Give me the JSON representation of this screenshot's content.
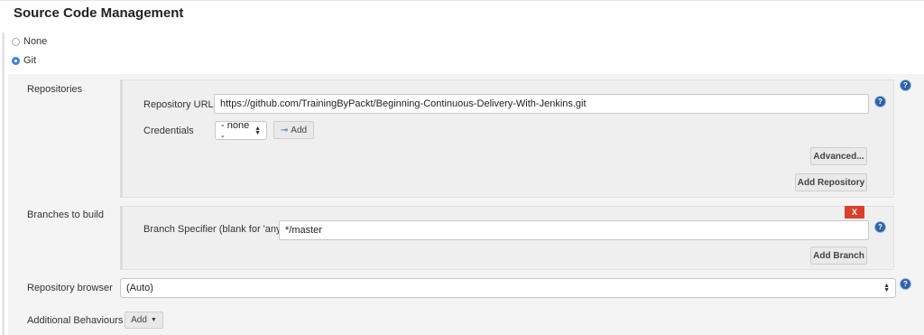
{
  "section": {
    "title": "Source Code Management"
  },
  "scm_options": [
    {
      "label": "None",
      "checked": false
    },
    {
      "label": "Git",
      "checked": true
    }
  ],
  "repositories": {
    "label": "Repositories",
    "url_label": "Repository URL",
    "url_value": "https://github.com/TrainingByPackt/Beginning-Continuous-Delivery-With-Jenkins.git",
    "credentials_label": "Credentials",
    "credentials_value": "- none -",
    "credentials_add_label": "Add",
    "advanced_label": "Advanced...",
    "add_repository_label": "Add Repository"
  },
  "branches": {
    "label": "Branches to build",
    "delete_label": "X",
    "specifier_label": "Branch Specifier (blank for 'any')",
    "specifier_value": "*/master",
    "add_branch_label": "Add Branch"
  },
  "repository_browser": {
    "label": "Repository browser",
    "value": "(Auto)"
  },
  "additional_behaviours": {
    "label": "Additional Behaviours",
    "add_label": "Add"
  },
  "icons": {
    "help": "?",
    "key_icon": "key-icon",
    "radio_icon": "radio-icon",
    "select_arrows_icon": "select-arrows-icon",
    "caret_icon": "caret-down-icon"
  },
  "colors": {
    "accent": "#3a86d6",
    "help_icon": "#2d63a8",
    "delete": "#d9402c"
  }
}
